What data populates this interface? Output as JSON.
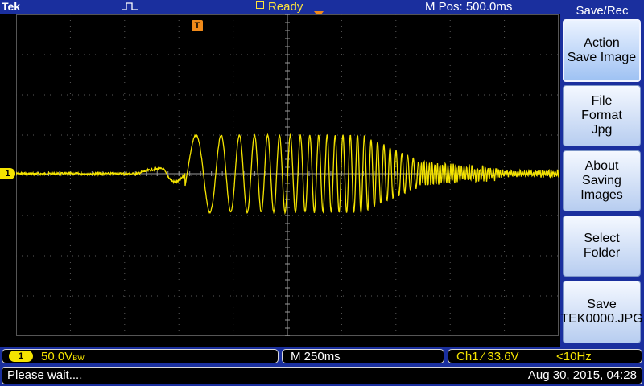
{
  "topbar": {
    "brand": "Tek",
    "acq_icon": "pulse-icon",
    "status": "Ready",
    "mpos": "M Pos: 500.0ms"
  },
  "display": {
    "ch1_marker": "1",
    "trigger_marker": "T",
    "trace_color": "#f5e400"
  },
  "menu": {
    "title": "Save/Rec",
    "items": [
      {
        "lines": [
          "Action",
          "Save Image"
        ]
      },
      {
        "lines": [
          "File",
          "Format",
          "Jpg"
        ]
      },
      {
        "lines": [
          "About",
          "Saving",
          "Images"
        ]
      },
      {
        "lines": [
          "Select",
          "Folder"
        ]
      },
      {
        "lines": [
          "Save",
          "TEK0000.JPG"
        ]
      }
    ]
  },
  "readouts": {
    "ch1_badge": "1",
    "ch1_scale": "50.0V",
    "ch1_bw": "BW",
    "timebase": "M 250ms",
    "trigger_source": "Ch1 ∕ 33.6V",
    "trigger_freq": "<10Hz"
  },
  "statusbar": {
    "message": "Please wait....",
    "datetime": "Aug 30, 2015, 04:28"
  },
  "colors": {
    "frame": "#1a2f9e",
    "ch1": "#f5e400",
    "trigger": "#f08a1a"
  }
}
